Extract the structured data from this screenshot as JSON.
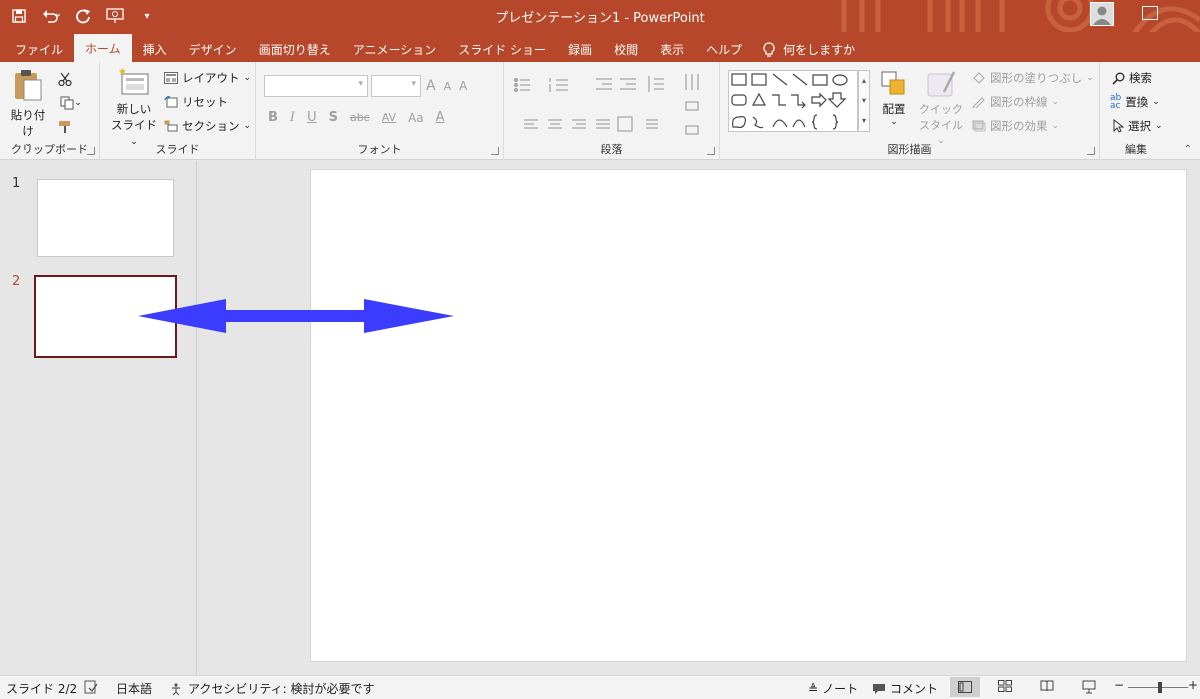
{
  "window": {
    "title": "プレゼンテーション1  -  PowerPoint",
    "accent_color": "#b7472a"
  },
  "qat": {
    "icons": [
      "save-icon",
      "undo-icon",
      "redo-icon",
      "start-from-beginning-icon",
      "customize-qat-icon"
    ]
  },
  "tabs": [
    {
      "label": "ファイル"
    },
    {
      "label": "ホーム",
      "active": true
    },
    {
      "label": "挿入"
    },
    {
      "label": "デザイン"
    },
    {
      "label": "画面切り替え"
    },
    {
      "label": "アニメーション"
    },
    {
      "label": "スライド ショー"
    },
    {
      "label": "録画"
    },
    {
      "label": "校閲"
    },
    {
      "label": "表示"
    },
    {
      "label": "ヘルプ"
    }
  ],
  "tell_me": "何をしますか",
  "ribbon": {
    "clipboard": {
      "paste": "貼り付け",
      "label": "クリップボード"
    },
    "slides": {
      "new_slide_1": "新しい",
      "new_slide_2": "スライド",
      "layout": "レイアウト",
      "reset": "リセット",
      "section": "セクション",
      "label": "スライド"
    },
    "font": {
      "label": "フォント",
      "bold": "B",
      "italic": "I",
      "underline": "U",
      "shadow": "S",
      "strike": "abc",
      "spacing": "AV",
      "case": "Aa",
      "grow": "A",
      "shrink": "A",
      "clear": "A"
    },
    "paragraph": {
      "label": "段落"
    },
    "drawing": {
      "arrange": "配置",
      "quick_style_1": "クイック",
      "quick_style_2": "スタイル",
      "fill": "図形の塗りつぶし",
      "outline": "図形の枠線",
      "effects": "図形の効果",
      "label": "図形描画"
    },
    "editing": {
      "find": "検索",
      "replace": "置換",
      "select": "選択",
      "label": "編集"
    }
  },
  "slides_pane": {
    "slides": [
      {
        "number": "1",
        "selected": false
      },
      {
        "number": "2",
        "selected": true
      }
    ]
  },
  "shape": {
    "type": "left-right-arrow",
    "fill": "#3c3cff"
  },
  "status": {
    "slide_pos": "スライド 2/2",
    "language": "日本語",
    "accessibility": "アクセシビリティ: 検討が必要です",
    "notes": "ノート",
    "comments": "コメント"
  }
}
